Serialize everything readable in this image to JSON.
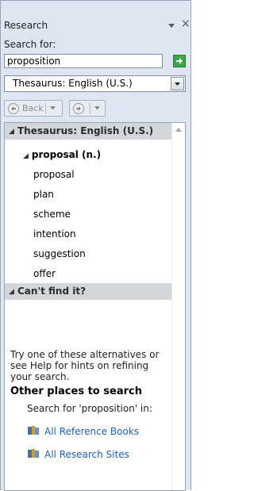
{
  "pane": {
    "title": "Research",
    "close_glyph": "×"
  },
  "search": {
    "label": "Search for:",
    "value": "proposition"
  },
  "source": {
    "selected": "Thesaurus: English (U.S.)"
  },
  "nav": {
    "back_label": "Back"
  },
  "results": {
    "section1": {
      "header": "Thesaurus: English (U.S.)"
    },
    "entry": {
      "headword": "proposal (n.)"
    },
    "synonyms": [
      "proposal",
      "plan",
      "scheme",
      "intention",
      "suggestion",
      "offer"
    ],
    "section2": {
      "header": "Can't find it?"
    },
    "alternatives_text": "Try one of these alternatives or see Help for hints on refining your search.",
    "other_places_heading": "Other places to search",
    "search_for_text": "Search for 'proposition' in:",
    "links": [
      "All Reference Books",
      "All Research Sites"
    ]
  },
  "icons": {
    "menu": "dropdown-arrow-icon",
    "go": "go-arrow-icon",
    "back": "back-arrow-icon",
    "forward": "forward-arrow-icon",
    "collapse": "collapse-triangle-icon",
    "book": "reference-book-icon"
  }
}
